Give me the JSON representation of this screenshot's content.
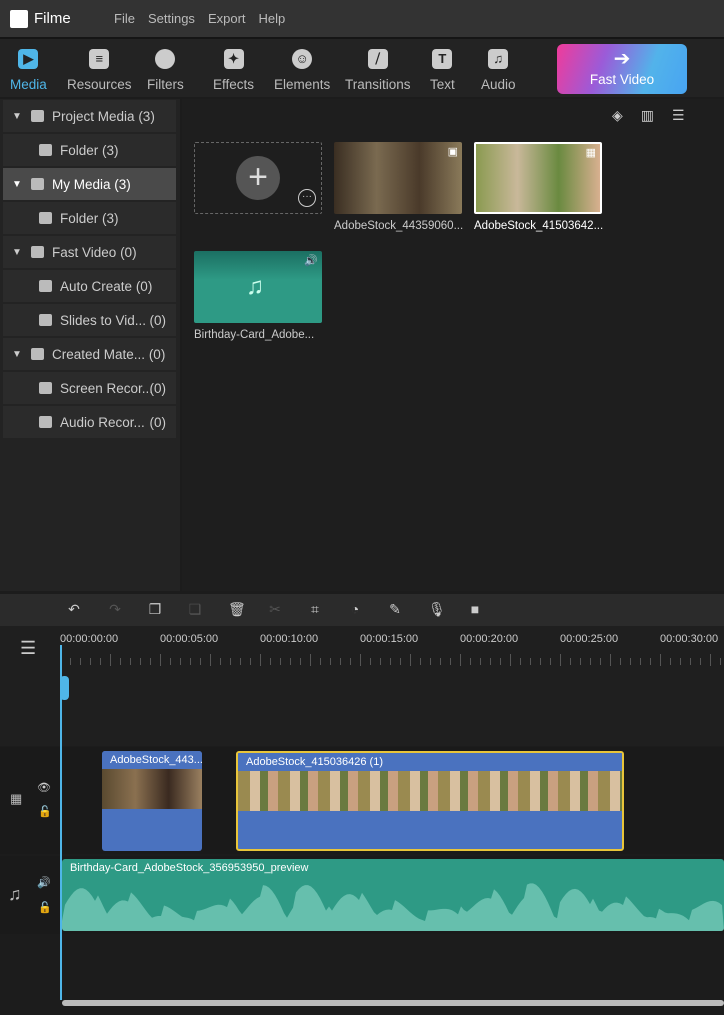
{
  "app": {
    "title": "Filme",
    "menu": [
      "File",
      "Settings",
      "Export",
      "Help"
    ]
  },
  "toolbar": {
    "tabs": [
      {
        "label": "Media",
        "icon": "media-icon",
        "active": true
      },
      {
        "label": "Resources",
        "icon": "resources-icon"
      },
      {
        "label": "Filters",
        "icon": "filters-icon"
      },
      {
        "label": "Effects",
        "icon": "effects-icon"
      },
      {
        "label": "Elements",
        "icon": "elements-icon"
      },
      {
        "label": "Transitions",
        "icon": "transitions-icon"
      },
      {
        "label": "Text",
        "icon": "text-icon"
      },
      {
        "label": "Audio",
        "icon": "audio-icon"
      }
    ],
    "fast_video": "Fast Video"
  },
  "sidebar": {
    "items": [
      {
        "label": "Project Media",
        "count": "(3)"
      },
      {
        "label": "Folder",
        "count": "(3)"
      },
      {
        "label": "My Media",
        "count": "(3)"
      },
      {
        "label": "Folder",
        "count": "(3)"
      },
      {
        "label": "Fast Video",
        "count": "(0)"
      },
      {
        "label": "Auto Create",
        "count": "(0)"
      },
      {
        "label": "Slides to Vid...",
        "count": "(0)"
      },
      {
        "label": "Created Mate...",
        "count": "(0)"
      },
      {
        "label": "Screen Recor...",
        "count": "(0)"
      },
      {
        "label": "Audio Recor...",
        "count": "(0)"
      }
    ]
  },
  "media": {
    "items": [
      {
        "name": "AdobeStock_44359060..."
      },
      {
        "name": "AdobeStock_41503642..."
      },
      {
        "name": "Birthday-Card_Adobe..."
      }
    ]
  },
  "timeline": {
    "ticks": [
      "00:00:00:00",
      "00:00:05:00",
      "00:00:10:00",
      "00:00:15:00",
      "00:00:20:00",
      "00:00:25:00",
      "00:00:30:00"
    ],
    "clips": {
      "video1": "AdobeStock_443...",
      "video2": "AdobeStock_415036426 (1)",
      "audio": "Birthday-Card_AdobeStock_356953950_preview"
    }
  },
  "colors": {
    "accent": "#4fb6e8",
    "clip": "#4a72bf",
    "audio": "#2e9a85",
    "selected": "#e8c53a"
  }
}
